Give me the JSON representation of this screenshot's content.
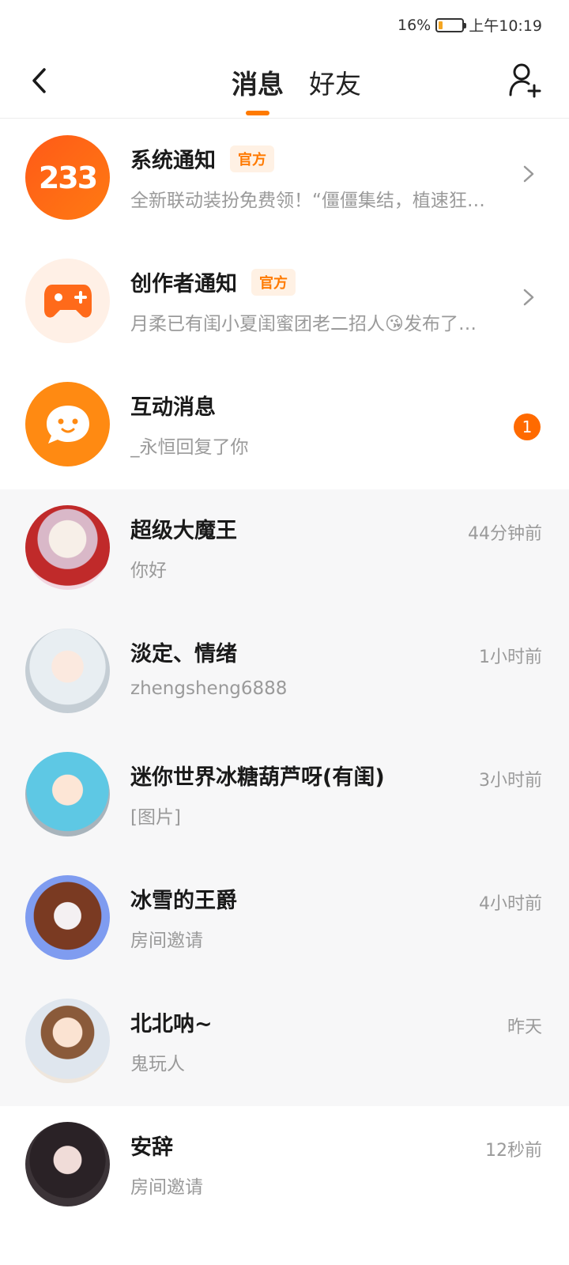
{
  "status": {
    "battery": "16%",
    "time": "上午10:19",
    "battery_level": 0.16
  },
  "header": {
    "tabs": [
      {
        "label": "消息"
      },
      {
        "label": "好友"
      }
    ]
  },
  "system_items": [
    {
      "title": "系统通知",
      "tag": "官方",
      "subtitle": "全新联动装扮免费领！“僵僵集结，植速狂…",
      "avatar_text": "233",
      "avatar_icon": "233-logo-icon"
    },
    {
      "title": "创作者通知",
      "tag": "官方",
      "subtitle": "月柔已有闺小夏闺蜜团老二招人😘发布了…",
      "avatar_icon": "gamepad-icon"
    },
    {
      "title": "互动消息",
      "subtitle": "_永恒回复了你",
      "badge": "1",
      "avatar_icon": "chat-smile-icon"
    }
  ],
  "chats": [
    {
      "name": "超级大魔王",
      "preview": "你好",
      "time": "44分钟前",
      "avatar_color": "#f1d6e0"
    },
    {
      "name": "淡定、情绪",
      "preview": "zhengsheng6888",
      "time": "1小时前",
      "avatar_color": "#dfe8ee"
    },
    {
      "name": "迷你世界冰糖葫芦呀(有闺)",
      "preview": "[图片]",
      "time": "3小时前",
      "avatar_color": "#7fd4e8"
    },
    {
      "name": "冰雪的王爵",
      "preview": "房间邀请",
      "time": "4小时前",
      "avatar_color": "#7f9cf0"
    },
    {
      "name": "北北呐~",
      "preview": "鬼玩人",
      "time": "昨天",
      "avatar_color": "#efe6dc"
    },
    {
      "name": "安辞",
      "preview": "房间邀请",
      "time": "12秒前",
      "avatar_color": "#3c3438"
    }
  ]
}
